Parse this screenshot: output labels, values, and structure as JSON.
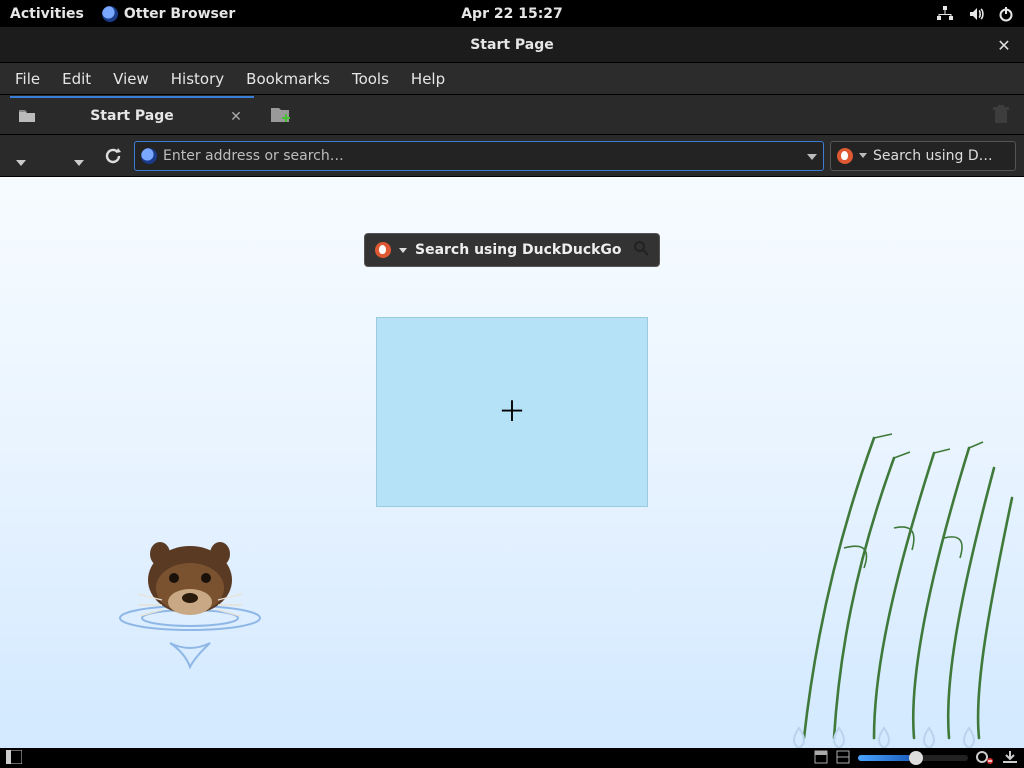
{
  "gnome": {
    "activities": "Activities",
    "app_name": "Otter Browser",
    "clock": "Apr 22  15:27"
  },
  "window": {
    "title": "Start Page"
  },
  "menu": {
    "file": "File",
    "edit": "Edit",
    "view": "View",
    "history": "History",
    "bookmarks": "Bookmarks",
    "tools": "Tools",
    "help": "Help"
  },
  "tab": {
    "title": "Start Page"
  },
  "address_bar": {
    "placeholder": "Enter address or search…"
  },
  "search_box": {
    "placeholder": "Search using D…"
  },
  "start_page": {
    "search_placeholder": "Search using DuckDuckGo"
  }
}
